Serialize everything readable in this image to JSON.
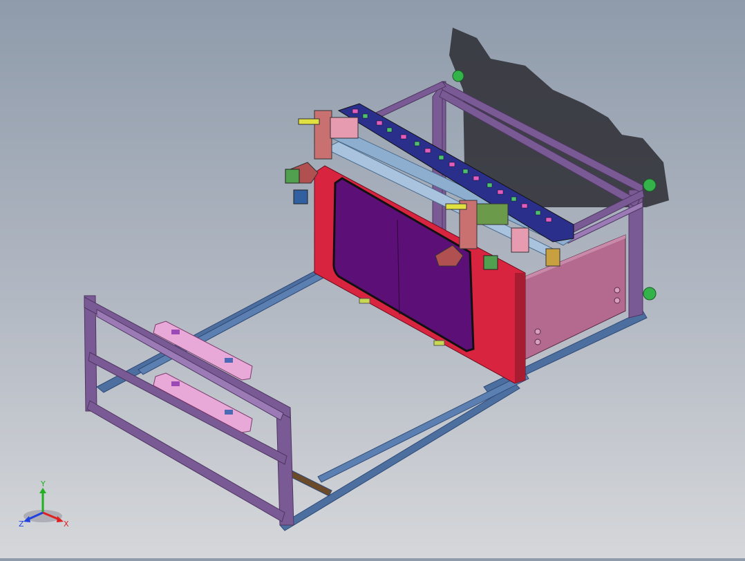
{
  "viewport": {
    "background_top": "#8f9bab",
    "background_bottom": "#d5d7da"
  },
  "model": {
    "frame_color": "#7a5a94",
    "base_rail_color": "#4c6f9f",
    "panel_color": "#d8243f",
    "window_color": "#5c0f76",
    "cabinet_color": "#b46a8e",
    "chain_color": "#2b2f8c",
    "shadow_color": "#2d2d33",
    "foot_color": "#34b34a"
  },
  "triad": {
    "x_label": "X",
    "y_label": "Y",
    "z_label": "Z",
    "x_color": "#e02020",
    "y_color": "#20b020",
    "z_color": "#2040e0"
  }
}
